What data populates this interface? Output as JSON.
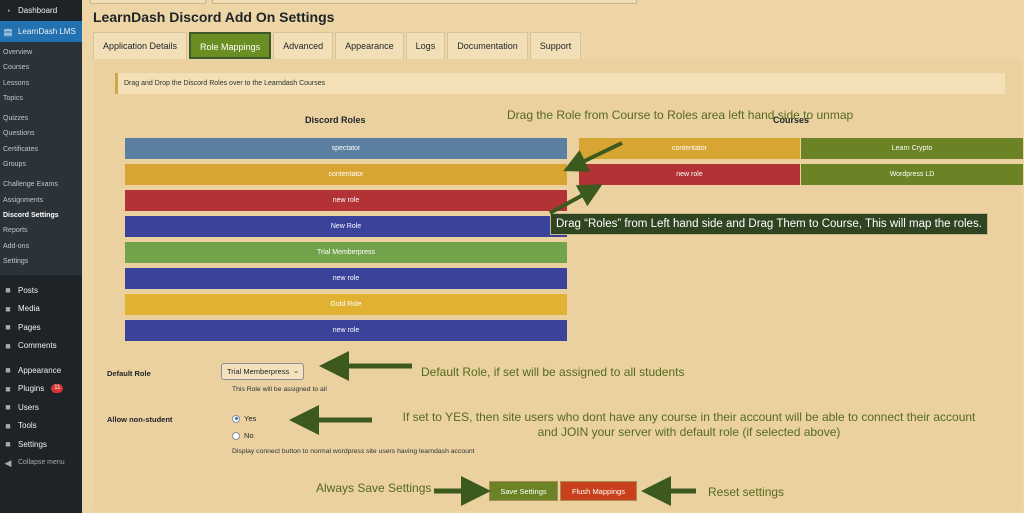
{
  "sidebar": {
    "dashboard": "Dashboard",
    "lms": "LearnDash LMS",
    "sub_items": [
      "Overview",
      "Courses",
      "Lessons",
      "Topics",
      "",
      "Quizzes",
      "Questions",
      "Certificates",
      "Groups",
      "",
      "Challenge Exams",
      "Assignments",
      "Discord Settings",
      "Reports",
      "Add-ons",
      "Settings"
    ],
    "main_items": [
      "Posts",
      "Media",
      "Pages",
      "Comments",
      "",
      "Appearance",
      "Plugins",
      "Users",
      "Tools",
      "Settings"
    ],
    "plugins_badge": "11",
    "collapse": "Collapse menu"
  },
  "header": {
    "title": "LearnDash Discord Add On Settings"
  },
  "tabs": [
    "Application Details",
    "Role Mappings",
    "Advanced",
    "Appearance",
    "Logs",
    "Documentation",
    "Support"
  ],
  "notice": "Drag and Drop the Discord Roles over to the Learndash Courses",
  "discord_roles": {
    "heading": "Discord Roles",
    "items": [
      {
        "label": "spectator",
        "color": "#5b7fa0"
      },
      {
        "label": "contentator",
        "color": "#d8a532"
      },
      {
        "label": "new role",
        "color": "#b23236"
      },
      {
        "label": "New Role",
        "color": "#3a429a"
      },
      {
        "label": "Trial Memberpress",
        "color": "#72a34b"
      },
      {
        "label": "new role",
        "color": "#3a429a"
      },
      {
        "label": "Gold Role",
        "color": "#e1b232"
      },
      {
        "label": "new role",
        "color": "#3a429a"
      }
    ]
  },
  "courses": {
    "heading": "Courses",
    "rows": [
      {
        "role": "contentator",
        "role_color": "#d8a532",
        "course": "Learn Crypto",
        "course_color": "#6b8324"
      },
      {
        "role": "new role",
        "role_color": "#b23236",
        "course": "Wordpress LD",
        "course_color": "#6b8324"
      }
    ]
  },
  "annotations": {
    "unmap": "Drag the Role from Course to Roles area left hand side to unmap",
    "map": "Drag “Roles” from Left hand side and Drag Them to Course, This will map the roles.",
    "default_role": "Default Role, if set will be assigned to all students",
    "non_student": "If set to YES, then site users who dont have any course in their account will be able to connect their account and JOIN your server with default role (if selected above)",
    "save": "Always Save Settings",
    "reset": "Reset settings"
  },
  "form": {
    "default_role_label": "Default Role",
    "default_role_value": "Trial Memberpress",
    "default_role_desc": "This Role will be assigned to all",
    "non_student_label": "Allow non-student",
    "yes": "Yes",
    "no": "No",
    "non_student_desc": "Display connect button to normal wordpress site users having learndash account",
    "save_button": "Save Settings",
    "flush_button": "Flush Mappings"
  },
  "colors": {
    "save": "#6b8324",
    "flush": "#c8401c",
    "arrow": "#3c5a1e",
    "accent": "#2271b1"
  }
}
